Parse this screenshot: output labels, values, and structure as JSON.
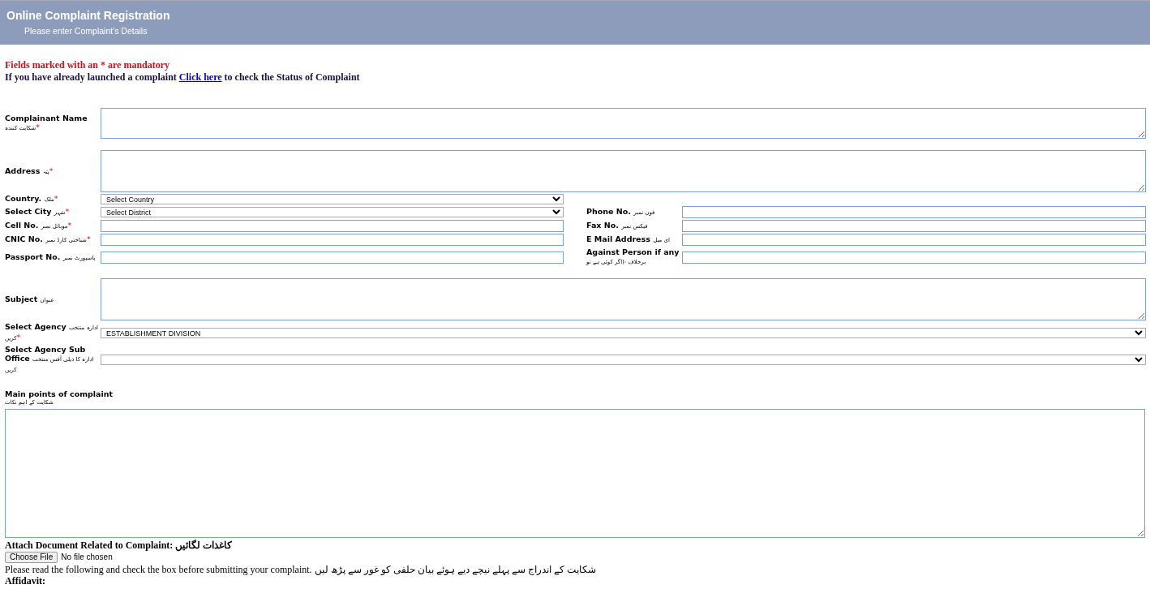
{
  "header": {
    "title": "Online Complaint Registration",
    "subtitle": "Please enter Complaint's Details"
  },
  "notice": {
    "mandatory": "Fields marked with an * are mandatory",
    "status_before": "If you have already launched a complaint",
    "status_link": "Click here",
    "status_after": "to check the Status of Complaint"
  },
  "form_rows": [
    {
      "field": {
        "label": "Complainant Name",
        "urdu": "شکایت کنندہ",
        "asterisk": "*",
        "kind": "textarea",
        "wide": true
      }
    },
    {
      "field": {
        "label": "Address",
        "urdu": "پتہ",
        "asterisk": "*",
        "kind": "textarea",
        "wide": true
      }
    },
    {
      "field": {
        "label": "Country.",
        "urdu": "ملک",
        "asterisk": "*",
        "kind": "select",
        "value": "Select Country",
        "wide": false
      }
    },
    {
      "field": {
        "label": "Select City",
        "urdu": "شہر",
        "asterisk": "*",
        "kind": "select",
        "value": "Select District",
        "wide": false
      },
      "side_field": {
        "label": "Phone No.",
        "urdu": "فون نمبر",
        "kind": "input"
      }
    },
    {
      "field": {
        "label": "Cell No.",
        "urdu": "موبائل نمبر",
        "asterisk": "*",
        "kind": "input",
        "wide": false
      },
      "side_field": {
        "label": "Fax No.",
        "urdu": "فیکس نمبر",
        "kind": "input"
      }
    },
    {
      "field": {
        "label": "CNIC No.",
        "urdu": "شناختی کارڈ نمبر",
        "asterisk": "*",
        "kind": "input",
        "wide": false
      },
      "side_field": {
        "label": "E Mail Address",
        "urdu": "ای میل",
        "kind": "input"
      }
    },
    {
      "field": {
        "label": "Passport No.",
        "urdu": "پاسپورٹ نمبر",
        "kind": "input",
        "wide": false
      },
      "side_field": {
        "label": "Against Person if any",
        "urdu": "برخلاف -(اگر کوئی ہے تو",
        "kind": "input"
      }
    },
    {
      "field": {
        "label": "Subject",
        "urdu": "عنوان",
        "kind": "textarea",
        "wide": true
      }
    },
    {
      "field": {
        "label": "Select Agency",
        "urdu": "ادارہ منتخب کریں",
        "asterisk": "*",
        "kind": "select",
        "value": "ESTABLISHMENT DIVISION",
        "wide": true
      }
    },
    {
      "field": {
        "label": "Select Agency Sub Office",
        "urdu": "ادارہ کا ذیلی آفس منتخب کریں",
        "kind": "select",
        "wide": true
      }
    }
  ],
  "main_points": {
    "label": "Main points of complaint",
    "urdu": "شکایت کے اہم نکات"
  },
  "attach": {
    "label": "Attach Document Related to Complaint: کاغذات لگائیں",
    "button": "Choose File",
    "status": "No file chosen"
  },
  "instruction": "Please read the following and check the box before submitting your complaint. شکایت کے اندراج سے پہلے نیچے دیے ہوئے بیان حلفی کو غور سے پڑھ لیں",
  "affidavit": "Affidavit:"
}
